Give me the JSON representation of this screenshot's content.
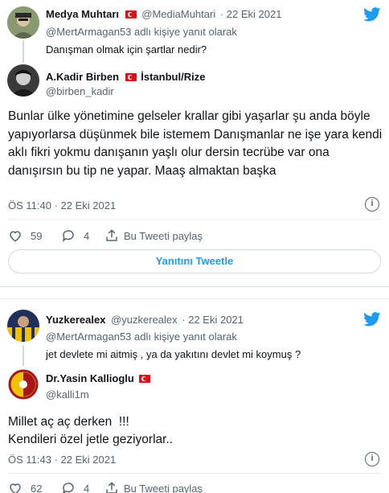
{
  "tweet1": {
    "author_name": "Medya Muhtarı",
    "author_handle": "@MediaMuhtari",
    "date": "· 22 Eki 2021",
    "reply_context": "@MertArmagan53 adlı kişiye yanıt olarak",
    "text": "Danışman olmak için şartlar nedir?",
    "reply": {
      "author_name": "A.Kadir Birben",
      "location": "İstanbul/Rize",
      "author_handle": "@birben_kadir",
      "text": "Bunlar ülke yönetimine gelseler krallar gibi yaşarlar şu anda böyle yapıyorlarsa düşünmek bile istemem Danışmanlar ne işe yara kendi aklı fikri yokmu danışanın yaşlı olur dersin tecrübe var ona danışırsın bu tip ne yapar. Maaş almaktan başka",
      "timestamp": "ÖS 11:40 · 22 Eki 2021",
      "likes": "59",
      "replies": "4",
      "share_label": "Bu Tweeti paylaş",
      "reply_button": "Yanıtını Tweetle"
    }
  },
  "tweet2": {
    "author_name": "Yuzkerealex",
    "author_handle": "@yuzkerealex",
    "date": "· 22 Eki 2021",
    "reply_context": "@MertArmagan53 adlı kişiye yanıt olarak",
    "text": "jet devlete mi aitmiş , ya da yakıtını devlet mi koymuş ?",
    "reply": {
      "author_name": "Dr.Yasin Kallioglu",
      "author_handle": "@kalli1m",
      "text_line1": "Millet aç aç derken  !!!",
      "text_line2": "Kendileri özel jetle geziyorlar..",
      "timestamp": "ÖS 11:43 · 22 Eki 2021",
      "likes": "62",
      "replies": "4",
      "share_label": "Bu Tweeti paylaş"
    }
  },
  "colors": {
    "accent": "#1d9bf0",
    "muted": "#536471",
    "flag": "#e30a17"
  }
}
